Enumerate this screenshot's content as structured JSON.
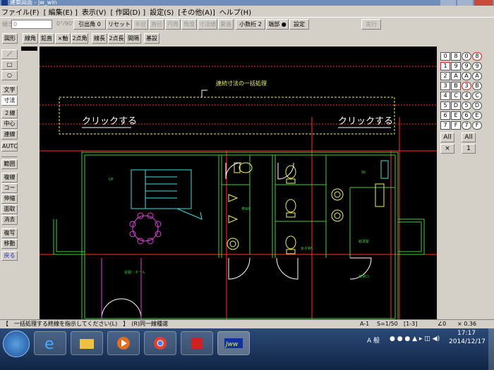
{
  "window": {
    "title": "建築図面 - jw_win",
    "min": "",
    "max": "",
    "close": ""
  },
  "menu": [
    "ファイル(F)",
    "[ 編集(E) ]",
    "表示(V)",
    "[ 作図(D) ]",
    "設定(S)",
    "[その他(A)]",
    "ヘルプ(H)"
  ],
  "toolbar1": {
    "angle_label": "傾き",
    "angle_value": "0",
    "angle_preset": "0°/90°",
    "buttons": [
      "引出角 0",
      "リセット",
      "半径",
      "直径",
      "円周",
      "角度",
      "寸法値",
      "累進",
      "小数桁 2",
      "端部 ●",
      "設定",
      "実行"
    ]
  },
  "toolbar2": [
    "図形",
    "線角",
    "鉛直",
    "×軸",
    "2点角",
    "線長",
    "2点長",
    "間隔",
    "基設"
  ],
  "left_tools": [
    "／",
    "□",
    "○",
    "文字",
    "寸法",
    "２線",
    "中心線",
    "連線",
    "AUTO",
    "範囲",
    "複線",
    "コーナー",
    "伸縮",
    "面取",
    "消去",
    "複写",
    "移動",
    "戻る"
  ],
  "right_tools": {
    "layers_left": [
      "0",
      "1",
      "2",
      "3",
      "4",
      "5",
      "6",
      "7"
    ],
    "layers_mid": [
      "8",
      "9",
      "A",
      "B",
      "C",
      "D",
      "E",
      "F"
    ],
    "groups": [
      "0",
      "1",
      "2",
      "3",
      "4",
      "5",
      "6",
      "7",
      "8",
      "9",
      "A",
      "B",
      "C",
      "D",
      "E",
      "F"
    ],
    "all_left": "All",
    "all_right": "All",
    "cross": "×",
    "one": "1"
  },
  "drawing": {
    "title": "連続寸法の一括処理",
    "click_left": "クリックする",
    "click_right": "クリックする",
    "rooms": {
      "up": "UP",
      "mens": "男WC",
      "womens": "女子WC",
      "kitchen": "給湯室",
      "entrance": "玄関・ホール",
      "emergency": "非常口",
      "sk": "SK"
    }
  },
  "status": {
    "message": "【　一括処理する終線を指示してください(L)　】　(R)同一線種選",
    "scale_a": "A-1",
    "scale_s": "S=1/50",
    "layer": "[1-3]",
    "angle": "∠0",
    "ratio": "× 0.36"
  },
  "taskbar": {
    "ime": "A 般",
    "time": "17:17",
    "date": "2014/12/17",
    "apps": [
      "start",
      "ie",
      "explorer",
      "media",
      "chrome",
      "acrobat",
      "jww"
    ]
  },
  "colors": {
    "canvas": "#000000",
    "red": "#ff3030",
    "green": "#40d040",
    "yellow": "#f0f060",
    "cyan": "#40e0e0",
    "magenta": "#e040e0",
    "white": "#ffffff"
  }
}
